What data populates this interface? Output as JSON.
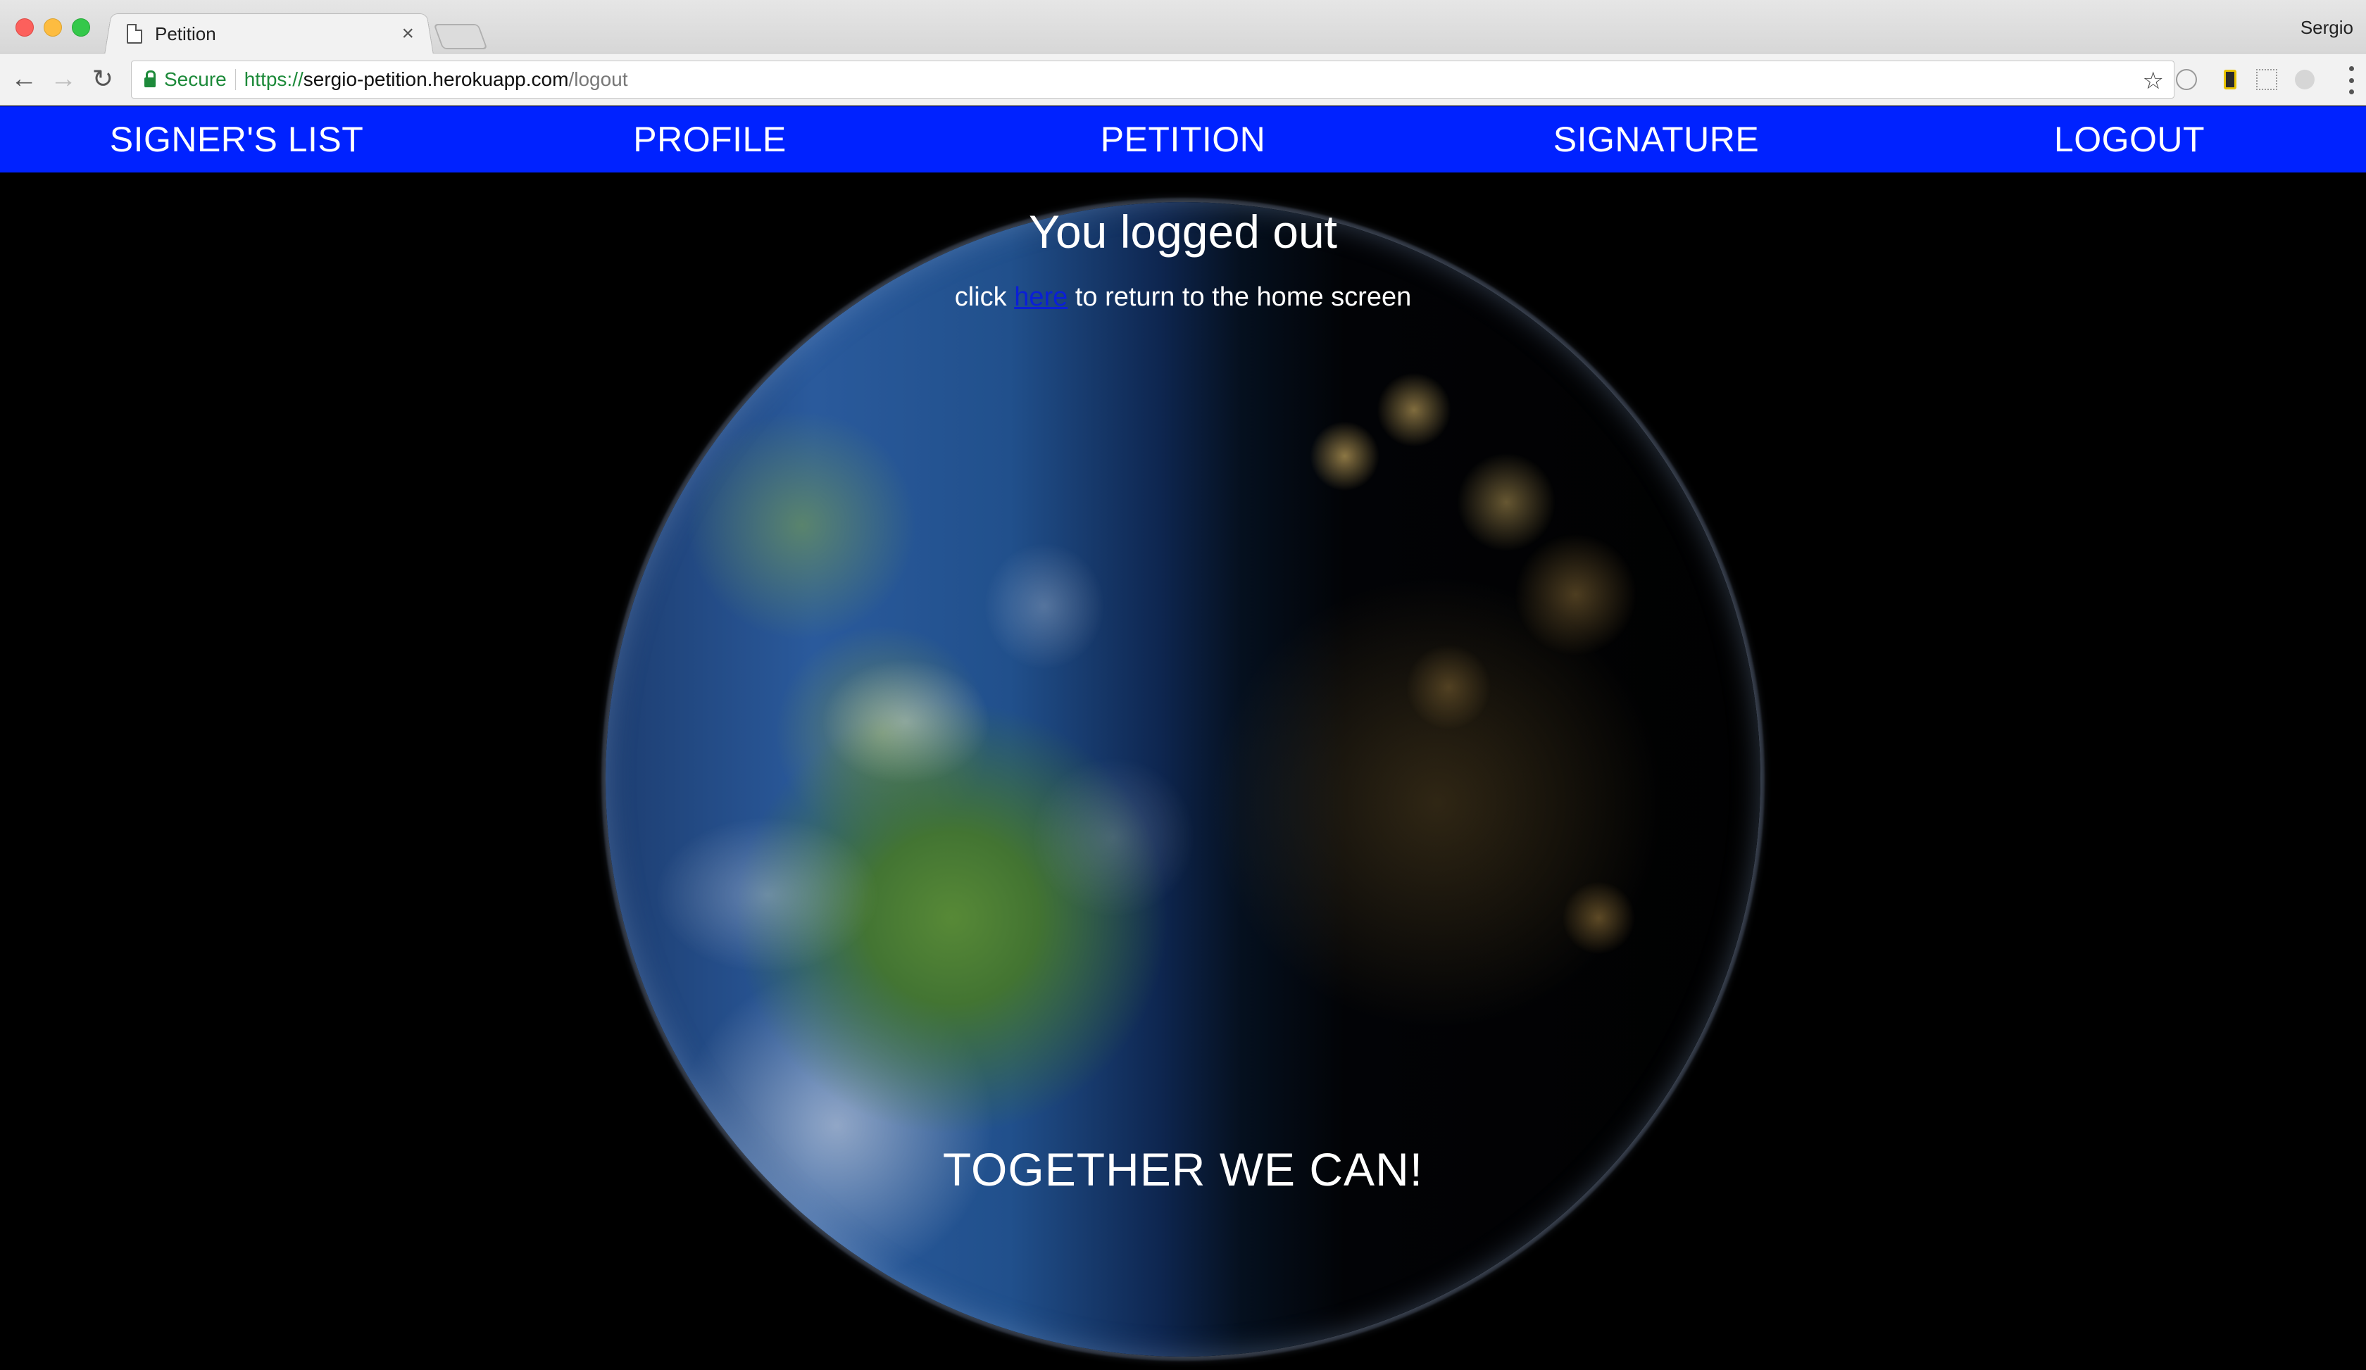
{
  "browser": {
    "tab_title": "Petition",
    "tab_close": "×",
    "profile_name": "Sergio",
    "secure_label": "Secure",
    "url_scheme": "https://",
    "url_host": "sergio-petition.herokuapp.com",
    "url_path": "/logout",
    "back_icon": "←",
    "forward_icon": "→",
    "reload_icon": "↻",
    "star_icon": "☆"
  },
  "site_nav": {
    "items": [
      {
        "label": "SIGNER'S LIST"
      },
      {
        "label": "PROFILE"
      },
      {
        "label": "PETITION"
      },
      {
        "label": "SIGNATURE"
      },
      {
        "label": "LOGOUT"
      }
    ]
  },
  "main": {
    "heading": "You logged out",
    "sub_before": "click ",
    "sub_link": "here",
    "sub_after": " to return to the home screen",
    "slogan": "TOGETHER WE CAN!"
  },
  "colors": {
    "nav_bg": "#0022ff",
    "page_bg": "#000000",
    "link": "#0a1fd6",
    "secure_green": "#1d8a3a"
  }
}
